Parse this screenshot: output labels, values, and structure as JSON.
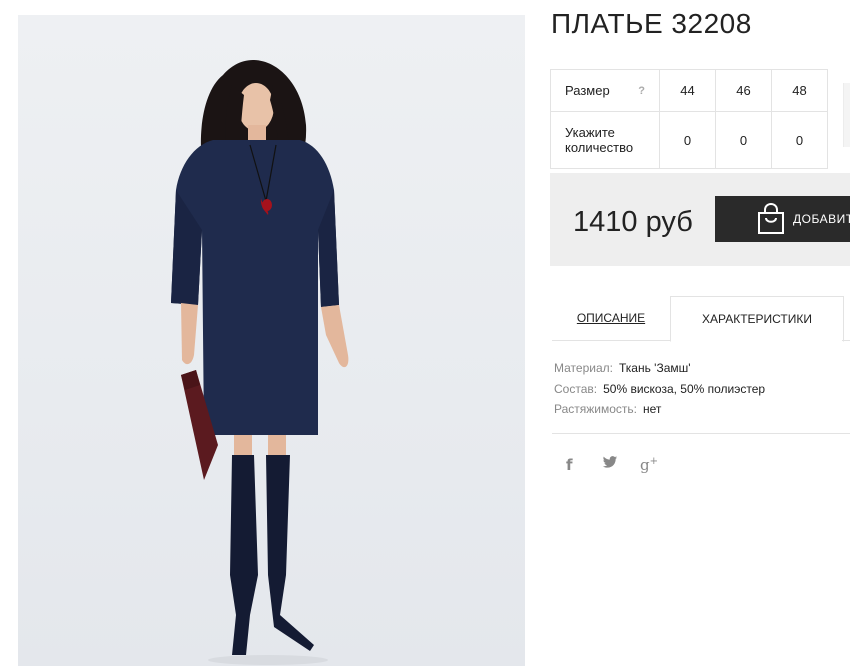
{
  "product": {
    "title": "ПЛАТЬЕ 32208",
    "price": "1410 руб"
  },
  "sizes": {
    "size_label": "Размер",
    "help_mark": "?",
    "qty_label": "Укажите количество",
    "options": [
      {
        "size": "44",
        "qty": "0"
      },
      {
        "size": "46",
        "qty": "0"
      },
      {
        "size": "48",
        "qty": "0"
      }
    ]
  },
  "buy_button": {
    "label": "ДОБАВИТ",
    "icon": "shopping-bag-icon"
  },
  "tabs": [
    {
      "label": "ОПИСАНИЕ",
      "active": false
    },
    {
      "label": "ХАРАКТЕРИСТИКИ",
      "active": true
    }
  ],
  "properties": [
    {
      "key": "Материал:",
      "value": "Ткань 'Замш'"
    },
    {
      "key": "Состав:",
      "value": "50% вискоза, 50% полиэстер"
    },
    {
      "key": "Растяжимость:",
      "value": "нет"
    }
  ],
  "social": {
    "facebook": "f",
    "twitter": "twitter-icon",
    "google_plus": "g",
    "google_plus_sup": "+"
  },
  "colors": {
    "dress": "#1f2b4d",
    "button": "#2a2a2a",
    "price_bg": "#eeeeee"
  }
}
